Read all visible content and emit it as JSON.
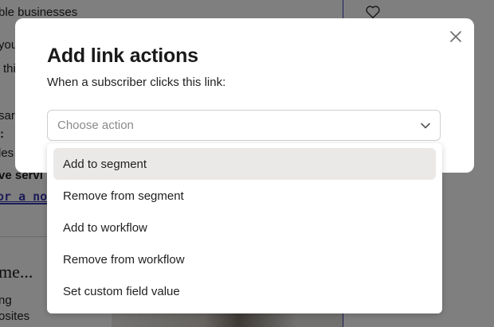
{
  "background": {
    "line1": "ble businesses",
    "line2": "you",
    "line3": "thi",
    "line4": "sar",
    "line5": ":",
    "line6": "les",
    "line7_a": "ve ",
    "line7_b": "servi",
    "line8": "or a nosy",
    "section_heading": "me...",
    "list1": "ng",
    "list2": "osites"
  },
  "modal": {
    "title": "Add link actions",
    "subtitle": "When a subscriber clicks this link:",
    "select_placeholder": "Choose action",
    "options": [
      {
        "label": "Add to segment"
      },
      {
        "label": "Remove from segment"
      },
      {
        "label": "Add to workflow"
      },
      {
        "label": "Remove from workflow"
      },
      {
        "label": "Set custom field value"
      }
    ]
  },
  "colors": {
    "overlay": "rgba(0,0,0,0.5)",
    "option_hover": "#ebe9e7",
    "bg_accent": "#3d3db8"
  },
  "icons": {
    "close": "close-icon",
    "chevron": "chevron-down-icon",
    "heart": "heart-icon"
  }
}
